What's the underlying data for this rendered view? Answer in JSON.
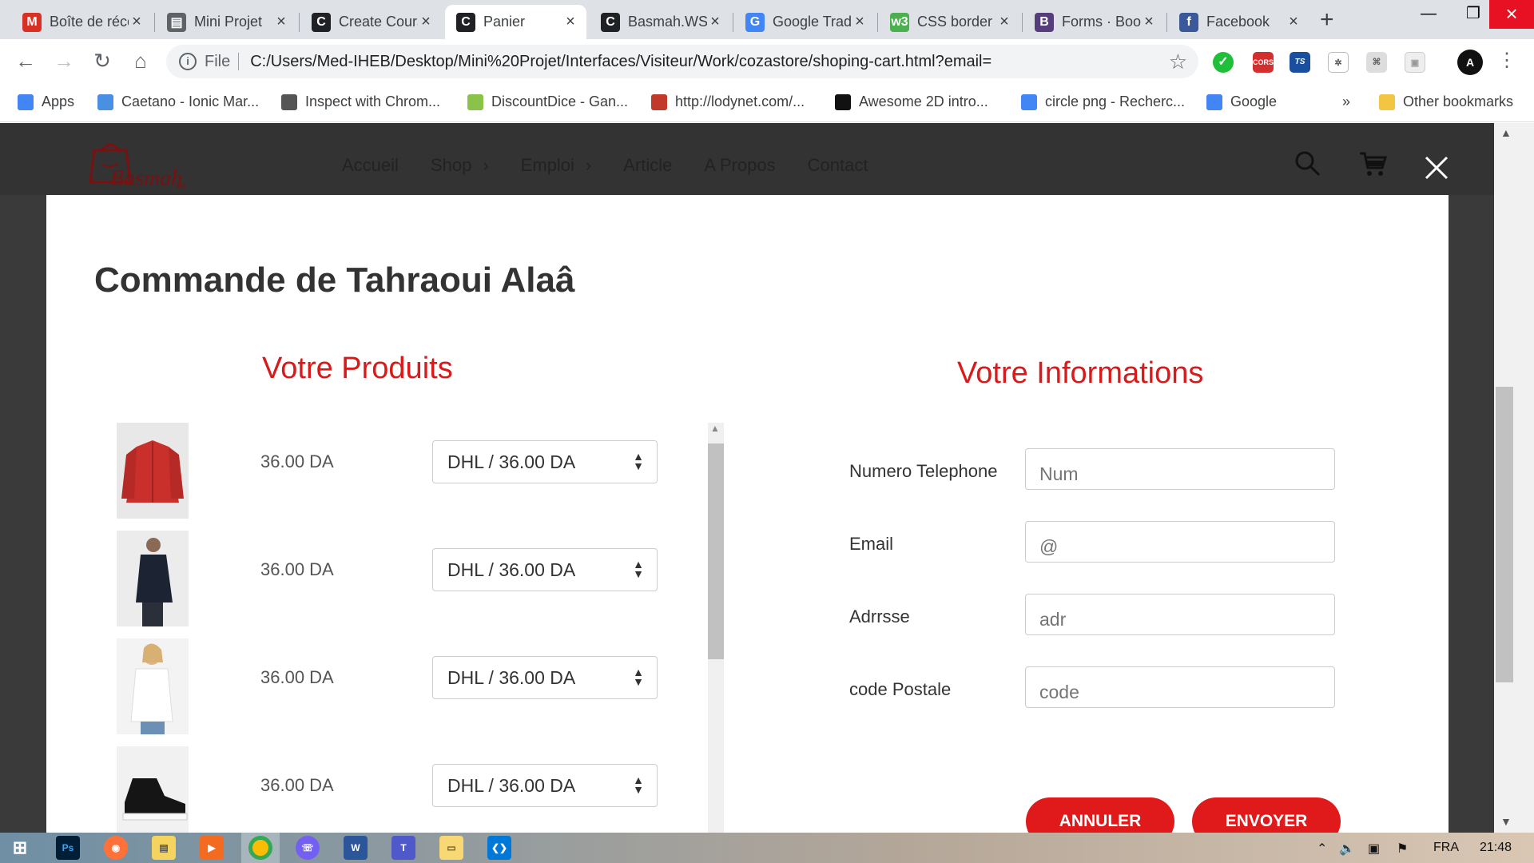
{
  "browser": {
    "tabs": [
      {
        "label": "Boîte de réception",
        "icon": "gmail-icon",
        "color": "#d93025",
        "glyph": "M"
      },
      {
        "label": "Mini Projet",
        "icon": "document-icon",
        "color": "#5f6368",
        "glyph": "▤"
      },
      {
        "label": "Create Course",
        "icon": "codepen-c-icon",
        "color": "#202124",
        "glyph": "C"
      },
      {
        "label": "Panier",
        "icon": "codepen-c-icon",
        "color": "#202124",
        "glyph": "C"
      },
      {
        "label": "Basmah.WS",
        "icon": "codepen-c-icon",
        "color": "#202124",
        "glyph": "C"
      },
      {
        "label": "Google Traduction",
        "icon": "google-translate-icon",
        "color": "#4285f4",
        "glyph": "G"
      },
      {
        "label": "CSS border",
        "icon": "w3schools-icon",
        "color": "#4caf50",
        "glyph": "w3"
      },
      {
        "label": "Forms · Bootstrap",
        "icon": "bootstrap-icon",
        "color": "#563d7c",
        "glyph": "B"
      },
      {
        "label": "Facebook",
        "icon": "facebook-icon",
        "color": "#3b5998",
        "glyph": "f"
      }
    ],
    "active_tab": 3,
    "url_scheme": "File",
    "url": "C:/Users/Med-IHEB/Desktop/Mini%20Projet/Interfaces/Visiteur/Work/cozastore/shoping-cart.html?email=",
    "bookmarks": [
      {
        "label": "Apps",
        "color": "#4285f4"
      },
      {
        "label": "Caetano - Ionic Mar...",
        "color": "#4a90e2"
      },
      {
        "label": "Inspect with Chrom...",
        "color": "#555555"
      },
      {
        "label": "DiscountDice - Gan...",
        "color": "#8bc34a"
      },
      {
        "label": "http://lodynet.com/...",
        "color": "#c0392b"
      },
      {
        "label": "Awesome 2D intro...",
        "color": "#111111"
      },
      {
        "label": "circle png - Recherc...",
        "color": "#4285f4"
      },
      {
        "label": "Google",
        "color": "#4285f4"
      }
    ],
    "bookmarks_overflow": "»",
    "other_bookmarks": "Other bookmarks"
  },
  "site": {
    "logo_text": "Basmah",
    "logo_sub": "WS",
    "nav": [
      {
        "label": "Accueil",
        "has_chevron": false
      },
      {
        "label": "Shop",
        "has_chevron": true
      },
      {
        "label": "Emploi",
        "has_chevron": true
      },
      {
        "label": "Article",
        "has_chevron": false
      },
      {
        "label": "A Propos",
        "has_chevron": false
      },
      {
        "label": "Contact",
        "has_chevron": false
      }
    ]
  },
  "modal": {
    "title": "Commande de Tahraoui Alaâ",
    "products_title": "Votre Produits",
    "info_title": "Votre Informations",
    "products": [
      {
        "image": "red-jacket",
        "price": "36.00 DA",
        "shipping": "DHL / 36.00 DA"
      },
      {
        "image": "navy-jacket-man",
        "price": "36.00 DA",
        "shipping": "DHL / 36.00 DA"
      },
      {
        "image": "white-shirt-woman",
        "price": "36.00 DA",
        "shipping": "DHL / 36.00 DA"
      },
      {
        "image": "black-sneaker",
        "price": "36.00 DA",
        "shipping": "DHL / 36.00 DA"
      }
    ],
    "form": {
      "phone_label": "Numero Telephone",
      "phone_placeholder": "Num",
      "email_label": "Email",
      "email_placeholder": "@",
      "address_label": "Adrrsse",
      "address_placeholder": "adr",
      "postal_label": "code Postale",
      "postal_placeholder": "code"
    },
    "cancel_label": "ANNULER",
    "send_label": "ENVOYER"
  },
  "taskbar": {
    "language": "FRA",
    "time": "21:48"
  },
  "colors": {
    "accent_red": "#e01a1a",
    "title_red": "#d81a1a",
    "header_dark": "#333333"
  }
}
